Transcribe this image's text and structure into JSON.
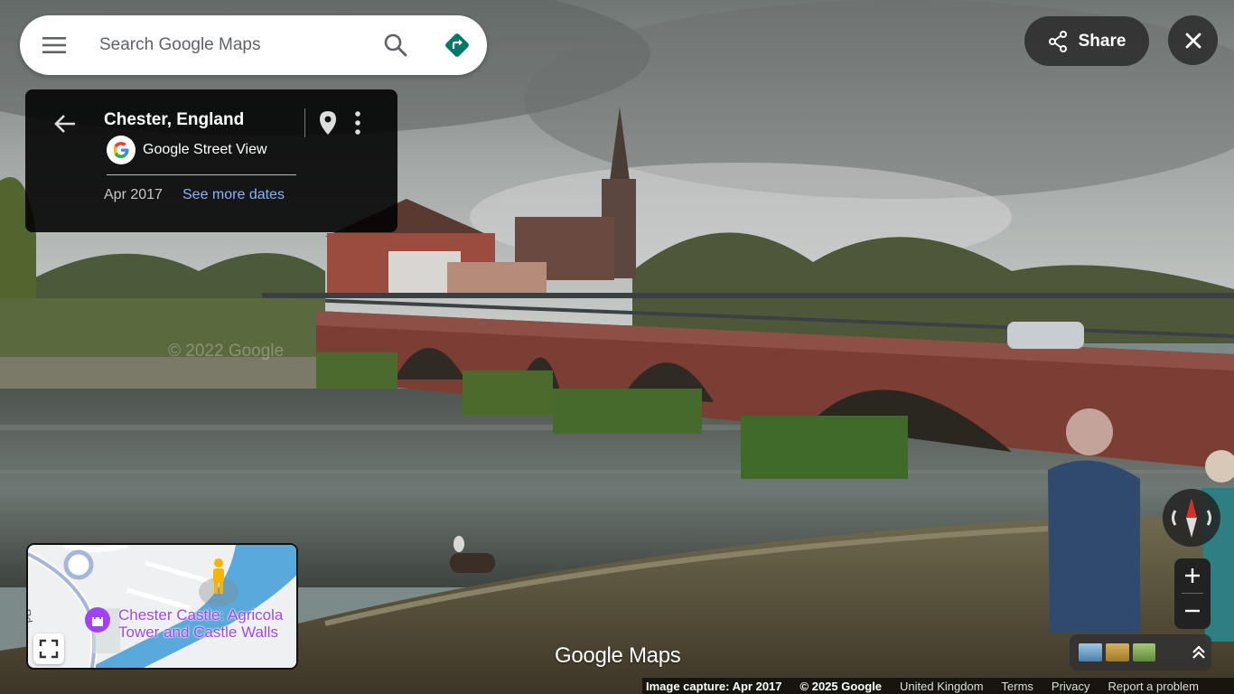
{
  "search": {
    "placeholder": "Search Google Maps"
  },
  "icons": {
    "menu": "menu-icon",
    "search": "search-icon",
    "directions": "directions-icon",
    "back": "arrow-left-icon",
    "google_logo": "google-g-logo",
    "pin": "location-pin-icon",
    "more": "more-vert-icon",
    "share": "share-icon",
    "close": "close-icon",
    "expand": "fullscreen-icon",
    "pegman": "pegman-icon",
    "compass": "compass-icon",
    "zoom_in": "plus-icon",
    "zoom_out": "minus-icon",
    "layers_expand": "chevron-double-up-icon"
  },
  "info_card": {
    "title": "Chester, England",
    "provider": "Google Street View",
    "capture_date": "Apr 2017",
    "see_more": "See more dates"
  },
  "share": {
    "label": "Share"
  },
  "watermark": "© 2022 Google",
  "minimap": {
    "poi_label": "Chester Castle: Agricola\nTower and Castle Walls",
    "road_label": "Rd"
  },
  "brand": {
    "text": "Google Maps"
  },
  "footer": {
    "image_capture": "Image capture: Apr 2017",
    "copyright": "© 2025 Google",
    "region": "United Kingdom",
    "terms": "Terms",
    "privacy": "Privacy",
    "report": "Report a problem"
  },
  "colors": {
    "directions_teal": "#00796b",
    "link_blue": "#8ab4f8",
    "poi_purple": "#a142f4",
    "river": "#5aa9dc",
    "compass_red": "#d93025"
  }
}
